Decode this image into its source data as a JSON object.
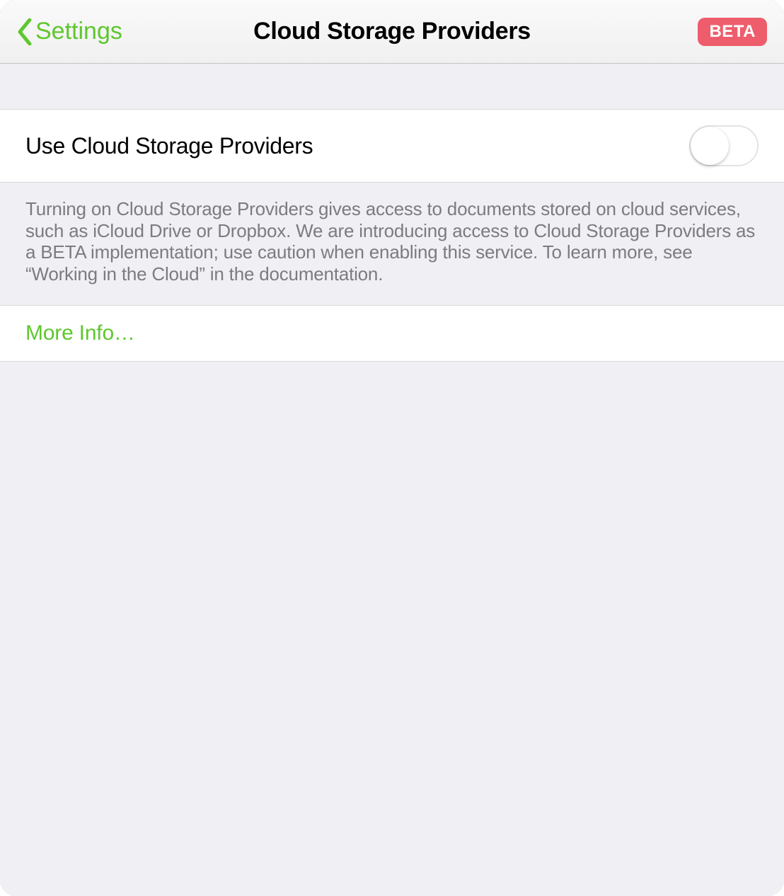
{
  "header": {
    "back_label": "Settings",
    "title": "Cloud Storage Providers",
    "badge": "BETA"
  },
  "toggle_row": {
    "label": "Use Cloud Storage Providers",
    "value": false
  },
  "description": "Turning on Cloud Storage Providers gives access to documents stored on cloud services, such as iCloud Drive or Dropbox. We are introducing access to Cloud Storage Providers as a BETA implementation; use caution when enabling this service. To learn more, see “Working in the Cloud” in the documentation.",
  "more_info": {
    "label": "More Info…"
  },
  "colors": {
    "accent": "#5ec72e",
    "badge_bg": "#ee5d6c"
  }
}
